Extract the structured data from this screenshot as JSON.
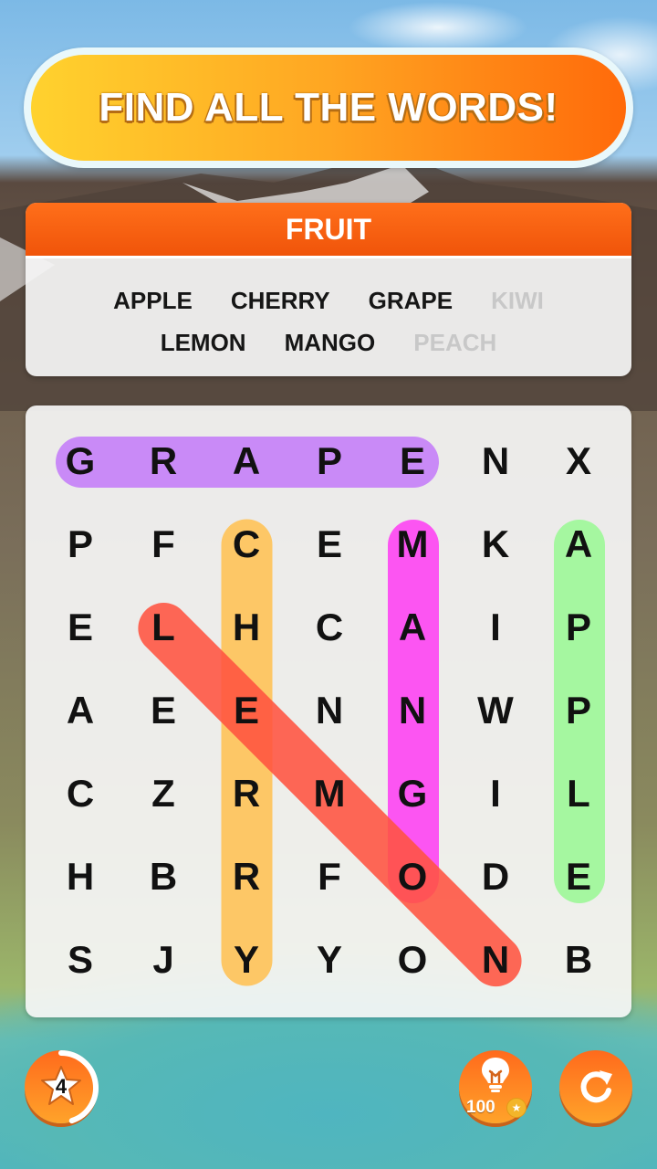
{
  "banner": {
    "text": "FIND ALL THE WORDS!"
  },
  "category": {
    "title": "FRUIT"
  },
  "word_list": {
    "rows": [
      [
        {
          "word": "APPLE",
          "found": true
        },
        {
          "word": "CHERRY",
          "found": true
        },
        {
          "word": "GRAPE",
          "found": true
        },
        {
          "word": "KIWI",
          "found": false
        }
      ],
      [
        {
          "word": "LEMON",
          "found": true
        },
        {
          "word": "MANGO",
          "found": true
        },
        {
          "word": "PEACH",
          "found": false
        }
      ]
    ]
  },
  "grid": {
    "rows": [
      [
        "G",
        "R",
        "A",
        "P",
        "E",
        "N",
        "X"
      ],
      [
        "P",
        "F",
        "C",
        "E",
        "M",
        "K",
        "A"
      ],
      [
        "E",
        "L",
        "H",
        "C",
        "A",
        "I",
        "P"
      ],
      [
        "A",
        "E",
        "E",
        "N",
        "N",
        "W",
        "P"
      ],
      [
        "C",
        "Z",
        "R",
        "M",
        "G",
        "I",
        "L"
      ],
      [
        "H",
        "B",
        "R",
        "F",
        "O",
        "D",
        "E"
      ],
      [
        "S",
        "J",
        "Y",
        "Y",
        "O",
        "N",
        "B"
      ]
    ],
    "found_words": [
      {
        "word": "GRAPE",
        "start": [
          0,
          0
        ],
        "end": [
          0,
          4
        ],
        "color": "#c98af7"
      },
      {
        "word": "CHERRY",
        "start": [
          1,
          2
        ],
        "end": [
          6,
          2
        ],
        "color": "#fdc766"
      },
      {
        "word": "MANGO",
        "start": [
          1,
          4
        ],
        "end": [
          5,
          4
        ],
        "color": "#fc55f2"
      },
      {
        "word": "APPLE",
        "start": [
          1,
          6
        ],
        "end": [
          5,
          6
        ],
        "color": "#a5f7a0"
      },
      {
        "word": "LEMON",
        "start": [
          2,
          1
        ],
        "end": [
          6,
          5
        ],
        "color": "#ff5340"
      }
    ]
  },
  "footer": {
    "level": "4",
    "level_progress": 0.45,
    "hint_cost": "100",
    "hint_icon": "lightbulb-icon",
    "restart_icon": "restart-icon",
    "coin_icon": "coin-star-icon"
  }
}
